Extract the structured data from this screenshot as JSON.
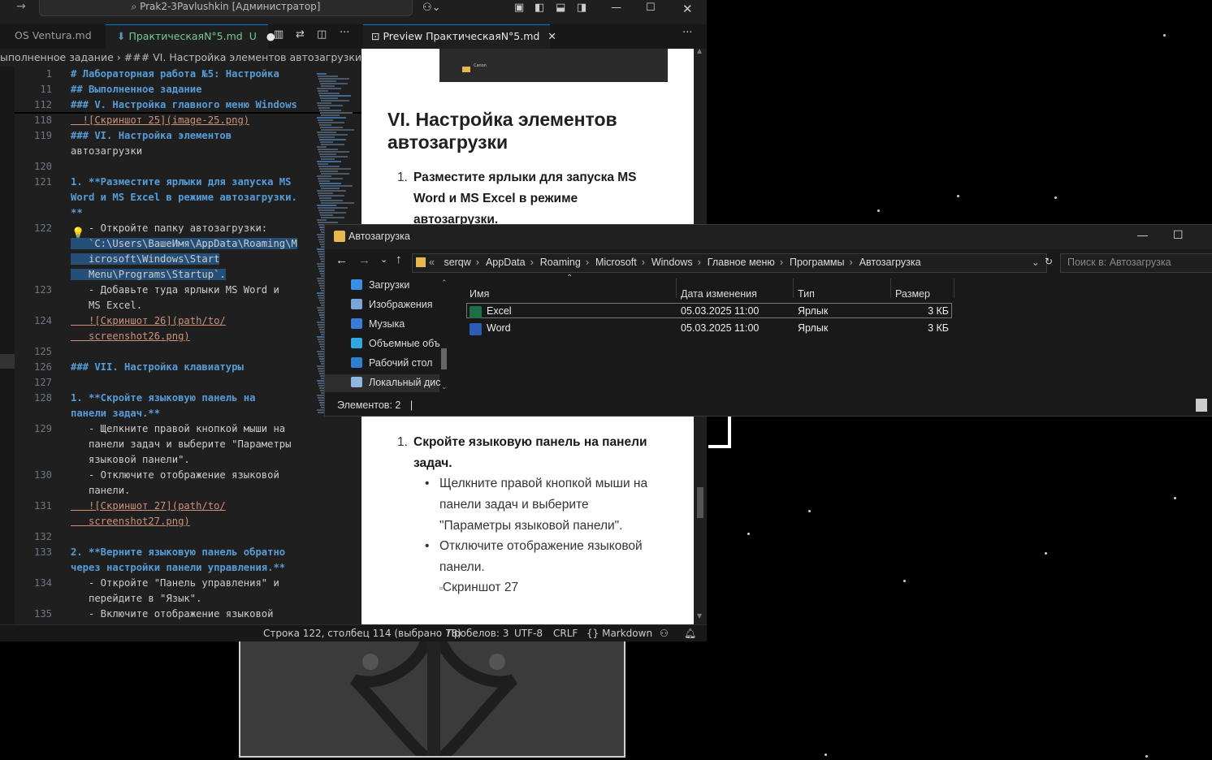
{
  "vscode": {
    "title": "Prak2-3Pavlushkin [Администратор]",
    "tabs": [
      {
        "label": "OS Ventura.md"
      },
      {
        "label": "ПрактическаяN°5.md",
        "status": "U"
      },
      {
        "label": "Preview ПрактическаяN°5.md"
      }
    ],
    "breadcrumb": "ыполненное задание  ›  ### VI. Настройка элементов автозагрузки",
    "editor_lines": [
      {
        "n": "1",
        "text": "# Лабораторная работа №5: Настройка"
      },
      {
        "n": "11",
        "text": "## Выполненное задание"
      },
      {
        "n": "112",
        "text": "### V. Настройка главного меню Windows"
      },
      {
        "n": "118",
        "text": "  ![Скриншот 25](image-25.png)"
      },
      {
        "n": "119",
        "text": "### VI. Настройка элементов"
      },
      {
        "n": "",
        "text": "автозагрузки"
      },
      {
        "n": "120",
        "text": ""
      },
      {
        "n": "121",
        "text": "1. **Разместите ярлыки для запуска MS"
      },
      {
        "n": "",
        "text": "Word и MS Excel в режиме автозагрузки."
      },
      {
        "n": "",
        "text": "**"
      },
      {
        "n": "122",
        "text": "   - Откройте папку автозагрузки:"
      },
      {
        "n": "",
        "text": "   `C:\\Users\\ВашеИмя\\AppData\\Roaming\\M"
      },
      {
        "n": "",
        "text": "   icrosoft\\Windows\\Start"
      },
      {
        "n": "",
        "text": "   Menu\\Programs\\Startup`."
      },
      {
        "n": "123",
        "text": "   - Добавьте туда ярлыки MS Word и"
      },
      {
        "n": "",
        "text": "   MS Excel."
      },
      {
        "n": "124",
        "text": "   ![Скриншот 26](path/to/"
      },
      {
        "n": "",
        "text": "   screenshot26.png)"
      },
      {
        "n": "125",
        "text": ""
      },
      {
        "n": "126",
        "text": "### VII. Настройка клавиатуры"
      },
      {
        "n": "127",
        "text": ""
      },
      {
        "n": "128",
        "text": "1. **Скройте языковую панель на"
      },
      {
        "n": "",
        "text": "панели задач.**"
      },
      {
        "n": "129",
        "text": "   - Щелкните правой кнопкой мыши на"
      },
      {
        "n": "",
        "text": "   панели задач и выберите \"Параметры"
      },
      {
        "n": "",
        "text": "   языковой панели\"."
      },
      {
        "n": "130",
        "text": "   - Отключите отображение языковой"
      },
      {
        "n": "",
        "text": "   панели."
      },
      {
        "n": "131",
        "text": "   ![Скриншот 27](path/to/"
      },
      {
        "n": "",
        "text": "   screenshot27.png)"
      },
      {
        "n": "132",
        "text": ""
      },
      {
        "n": "133",
        "text": "2. **Верните языковую панель обратно"
      },
      {
        "n": "",
        "text": "через настройки панели управления.**"
      },
      {
        "n": "134",
        "text": "   - Откройте \"Панель управления\" и"
      },
      {
        "n": "",
        "text": "   перейдите в \"Язык\"."
      },
      {
        "n": "135",
        "text": "   - Включите отображение языковой"
      }
    ],
    "preview": {
      "h2": "VI. Настройка элементов автозагрузки",
      "item1_bold": "Разместите ярлыки для запуска MS Word и MS Excel в режиме автозагрузки.",
      "item2_bold": "Скройте языковую панель на панели задач.",
      "bullet1": "Щелкните правой кнопкой мыши на панели задач и выберите \"Параметры языковой панели\".",
      "bullet2": "Отключите отображение языковой панели.",
      "img_alt": "Скриншот 27",
      "thumb_label": "Canon"
    },
    "status": {
      "position": "Строка 122, столбец 114 (выбрано 78)",
      "spaces": "Пробелов: 3",
      "encoding": "UTF-8",
      "eol": "CRLF",
      "language": "Markdown"
    }
  },
  "explorer": {
    "title": "Автозагрузка",
    "path": [
      "serqw",
      "AppData",
      "Roaming",
      "Microsoft",
      "Windows",
      "Главное меню",
      "Программы",
      "Автозагрузка"
    ],
    "search_placeholder": "Поиск в: Автозагрузка",
    "nav": [
      "Загрузки",
      "Изображения",
      "Музыка",
      "Объемные объ",
      "Рабочий стол",
      "Локальный дис"
    ],
    "columns": [
      "Имя",
      "Дата изменения",
      "Тип",
      "Размер"
    ],
    "files": [
      {
        "name": "Excel",
        "date": "05.03.2025 11:00",
        "type": "Ярлык",
        "size": "3 КБ"
      },
      {
        "name": "Word",
        "date": "05.03.2025 11:00",
        "type": "Ярлык",
        "size": "3 КБ"
      }
    ],
    "status": "Элементов: 2"
  },
  "colors": {
    "accent": "#0078d4",
    "heading": "#569cd6",
    "link": "#ce9178",
    "selection": "#264f78",
    "excel": "#1d7044",
    "word": "#2b5db8"
  }
}
